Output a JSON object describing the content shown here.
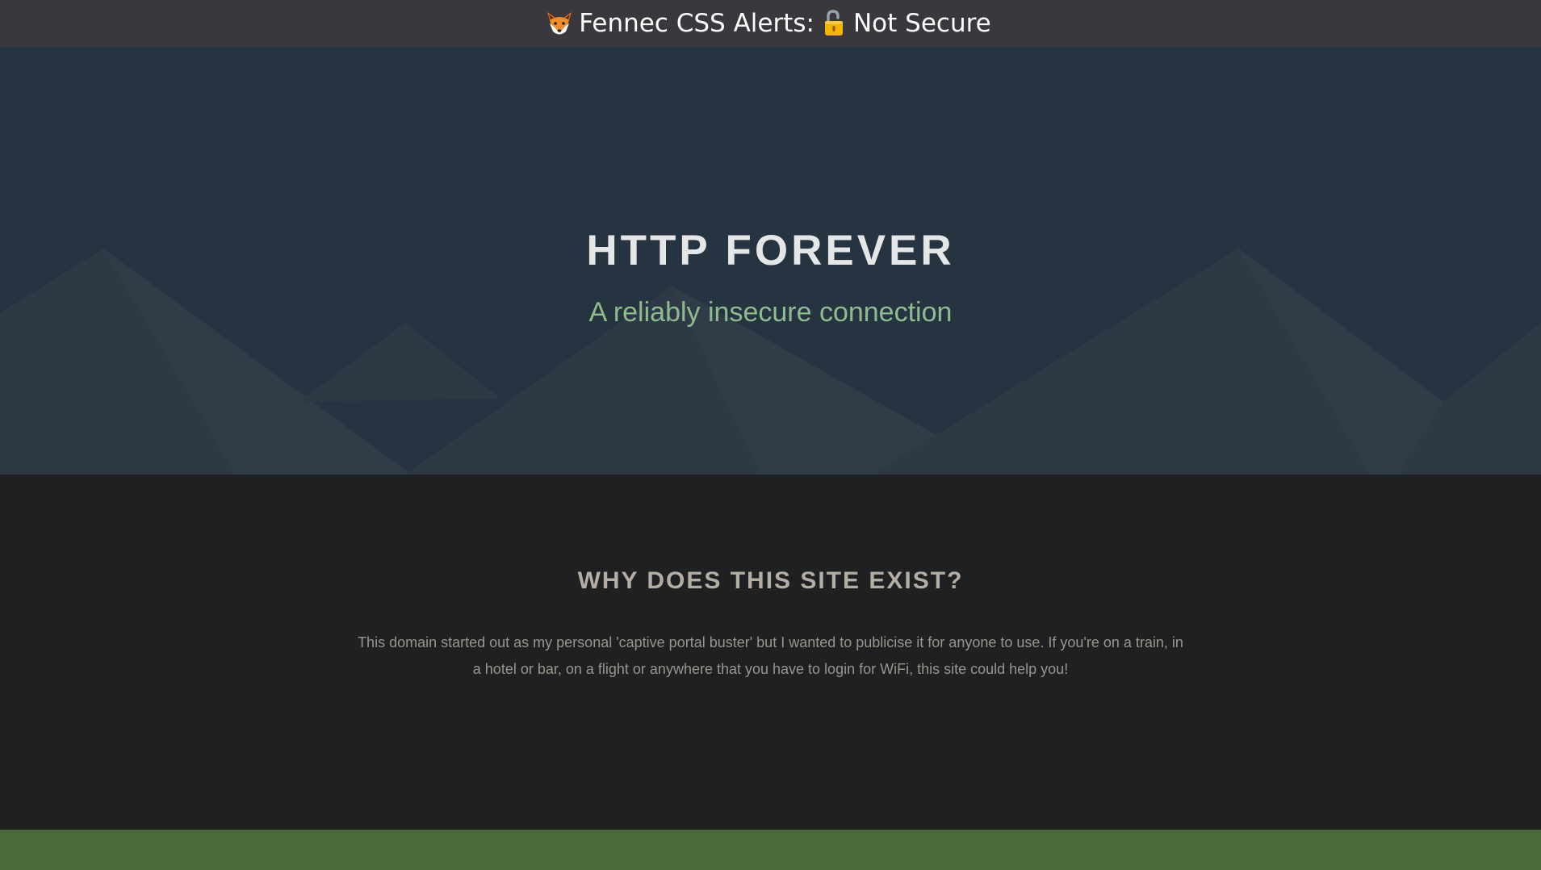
{
  "alert_bar": {
    "prefix_icon": "fox-icon",
    "label": "Fennec CSS Alerts:",
    "status_icon": "open-lock-icon",
    "status": "Not Secure"
  },
  "hero": {
    "title": "HTTP FOREVER",
    "subtitle": "A reliably insecure connection"
  },
  "about": {
    "heading": "WHY DOES THIS SITE EXIST?",
    "body": "This domain started out as my personal 'captive portal buster' but I wanted to publicise it for anyone to use. If you're on a train, in a hotel or bar, on a flight or anywhere that you have to login for WiFi, this site could help you!"
  },
  "colors": {
    "alert_bar_bg": "#38383d",
    "hero_bg": "#263340",
    "subtitle": "#8fbc8f",
    "section_bg": "#1f2022",
    "footer_band": "#4a6a3c"
  }
}
